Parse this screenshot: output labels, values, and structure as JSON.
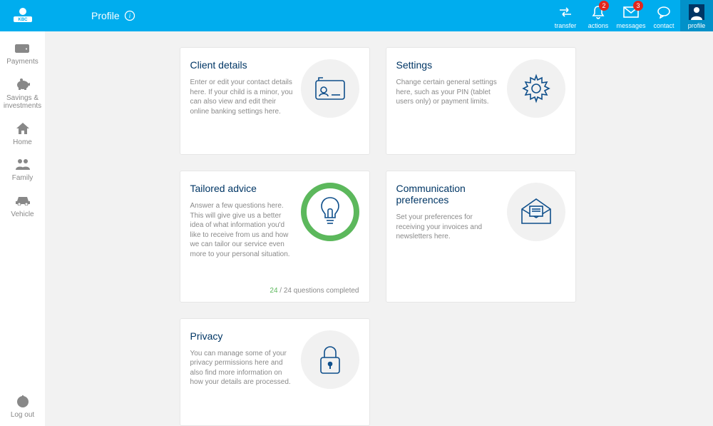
{
  "header": {
    "brand": "KBC",
    "page_title": "Profile",
    "actions": {
      "transfer": "transfer",
      "actions": "actions",
      "actions_badge": "2",
      "messages": "messages",
      "messages_badge": "3",
      "contact": "contact",
      "profile": "profile"
    }
  },
  "sidebar": {
    "payments": "Payments",
    "savings": "Savings & investments",
    "home": "Home",
    "family": "Family",
    "vehicle": "Vehicle",
    "logout": "Log out"
  },
  "cards": {
    "client": {
      "title": "Client details",
      "desc": "Enter or edit your contact details here.\nIf your child is a minor, you can also view and edit their online banking settings here."
    },
    "settings": {
      "title": "Settings",
      "desc": "Change certain general settings here, such as your PIN (tablet users only) or payment limits."
    },
    "tailored": {
      "title": "Tailored advice",
      "desc": "Answer a few questions here. This will give give us a better idea of what information you'd like to receive from us and how we can tailor our service even more to your personal situation.",
      "progress_done": "24",
      "progress_total": " / 24 questions completed"
    },
    "comm": {
      "title": "Communication preferences",
      "desc": "Set your preferences for receiving your invoices and newsletters here."
    },
    "privacy": {
      "title": "Privacy",
      "desc": "You can manage some of your privacy permissions here and also find more information on how your details are processed."
    }
  }
}
